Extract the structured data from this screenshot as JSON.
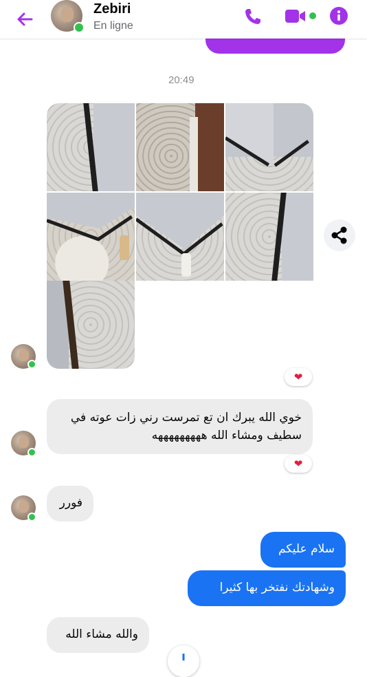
{
  "header": {
    "contact_name": "Zebiri",
    "contact_status": "En ligne"
  },
  "icons": {
    "back": "arrow-left",
    "call": "phone",
    "video": "video-camera",
    "info": "info-circle",
    "share": "share",
    "reaction": "heart"
  },
  "colors": {
    "accent": "#a233e8",
    "outgoing_bubble": "#1a73f2",
    "incoming_bubble": "#ececec",
    "online": "#31c24d",
    "heart": "#e41e3f"
  },
  "chat": {
    "timestamp": "20:49",
    "messages": [
      {
        "from": "contact",
        "text": "خوي الله يبرك ان تع تمرست  رني زات عوته في سطيف ومشاء الله هههههههههه"
      },
      {
        "from": "contact",
        "text": "فورر"
      },
      {
        "from": "me",
        "text": "سلام عليكم"
      },
      {
        "from": "me",
        "text": "وشهادتك نفتخر بها كثيرا"
      },
      {
        "from": "contact",
        "text": "والله مشاء الله"
      }
    ],
    "reaction": "❤"
  }
}
